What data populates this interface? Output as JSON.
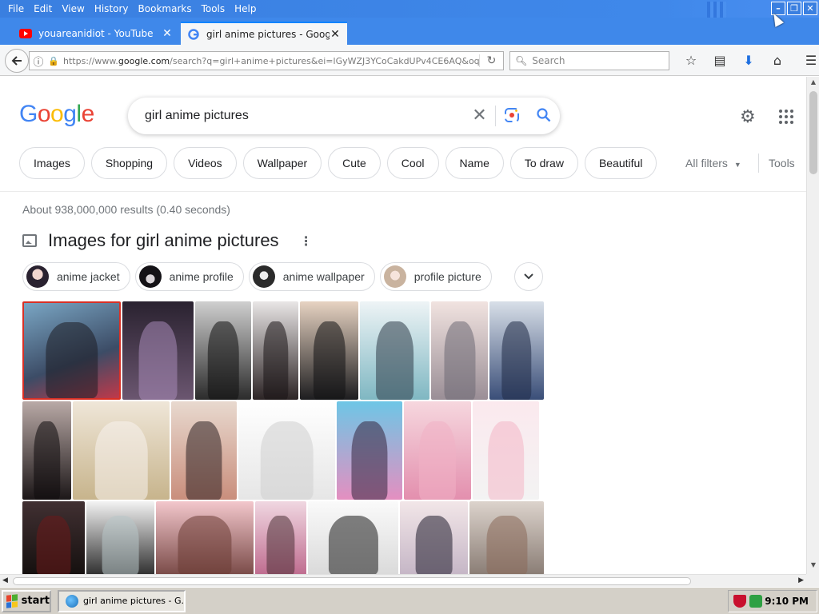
{
  "menu": [
    {
      "label": "File"
    },
    {
      "label": "Edit"
    },
    {
      "label": "View"
    },
    {
      "label": "History"
    },
    {
      "label": "Bookmarks"
    },
    {
      "label": "Tools"
    },
    {
      "label": "Help"
    }
  ],
  "tabs": [
    {
      "title": "youareanidiot - YouTube"
    },
    {
      "title": "girl anime pictures - Google Sea"
    }
  ],
  "navbar": {
    "url_prefix": "https://www.",
    "url_domain": "google.com",
    "url_rest": "/search?q=girl+anime+pictures&ei=lGyWZJ3YCoCakdUPv4CE6AQ&oq=girl+",
    "search_placeholder": "Search"
  },
  "google": {
    "logo": "Google",
    "query": "girl anime pictures",
    "chips": [
      "Images",
      "Shopping",
      "Videos",
      "Wallpaper",
      "Cute",
      "Cool",
      "Name",
      "To draw",
      "Beautiful"
    ],
    "all_filters": "All filters",
    "tools": "Tools",
    "stats": "About 938,000,000 results (0.40 seconds)",
    "images_heading": "Images for girl anime pictures",
    "refinements": [
      {
        "label": "anime jacket"
      },
      {
        "label": "anime profile"
      },
      {
        "label": "anime wallpaper"
      },
      {
        "label": "profile picture"
      }
    ]
  },
  "taskbar": {
    "start": "start",
    "task": "girl anime pictures - G...",
    "clock": "9:10 PM"
  },
  "colors": {
    "titlebar": "#3f88ea",
    "google_blue": "#4285f4",
    "google_red": "#ea4335",
    "google_yellow": "#fbbc05",
    "google_green": "#34a853"
  }
}
